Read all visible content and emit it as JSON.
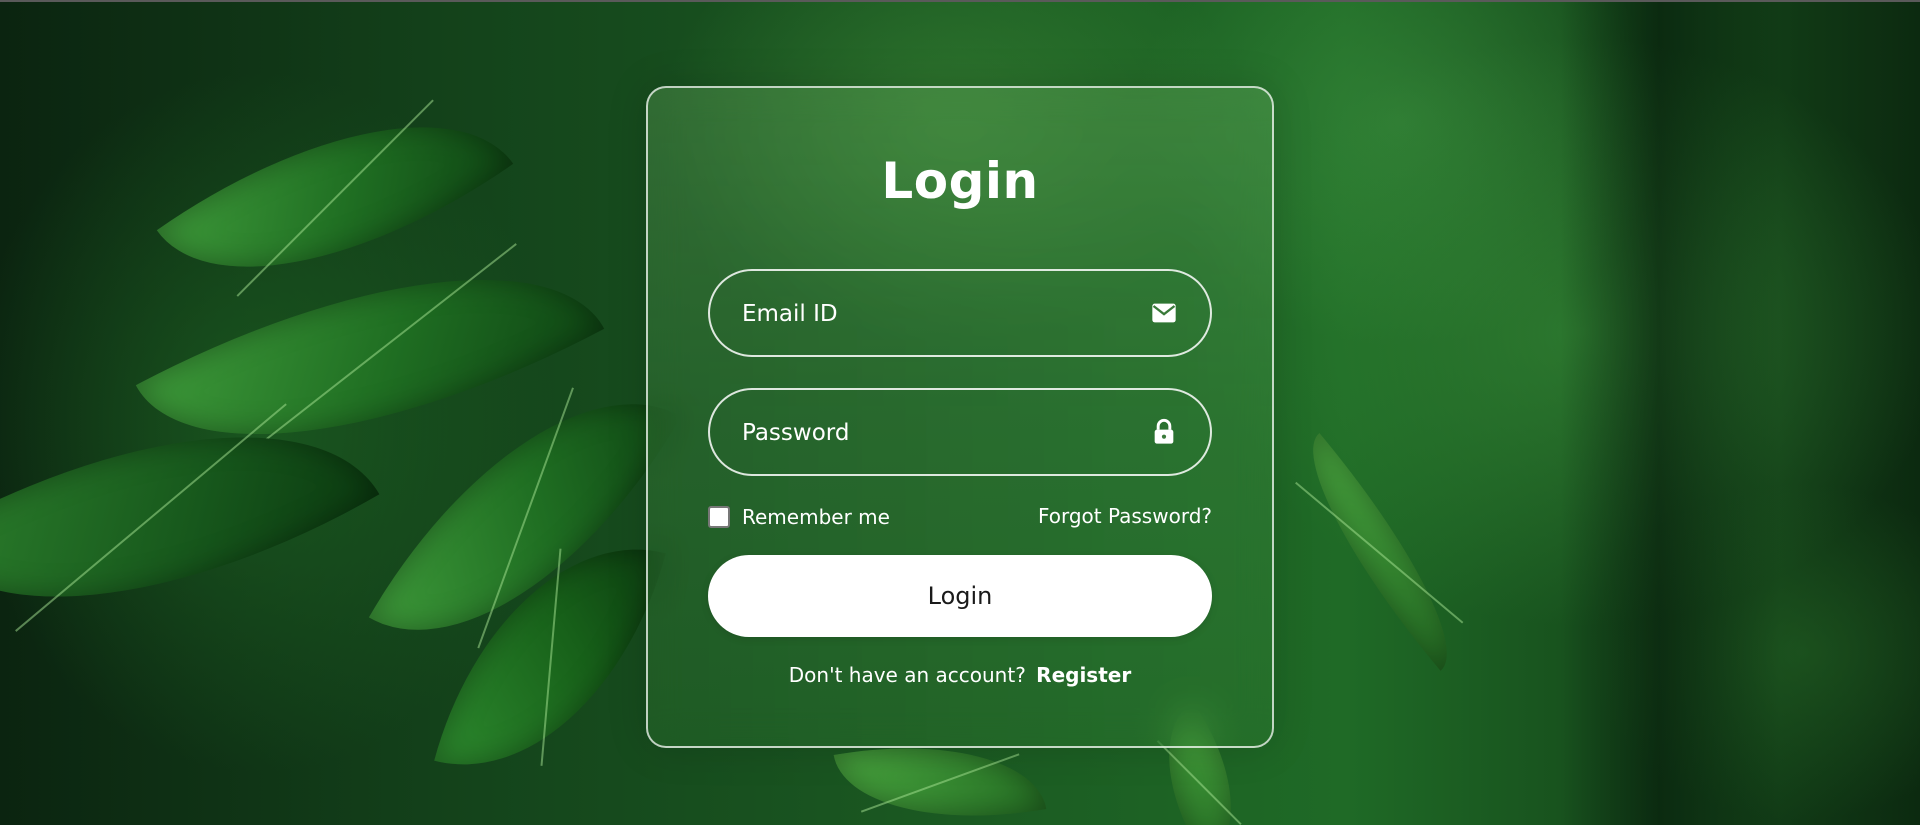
{
  "form": {
    "title": "Login",
    "email_placeholder": "Email ID",
    "email_icon": "mail-icon",
    "password_placeholder": "Password",
    "password_icon": "lock-icon",
    "remember_label": "Remember me",
    "remember_checked": false,
    "forgot_label": "Forgot Password?",
    "submit_label": "Login",
    "register_prompt": "Don't have an account?",
    "register_label": "Register"
  }
}
